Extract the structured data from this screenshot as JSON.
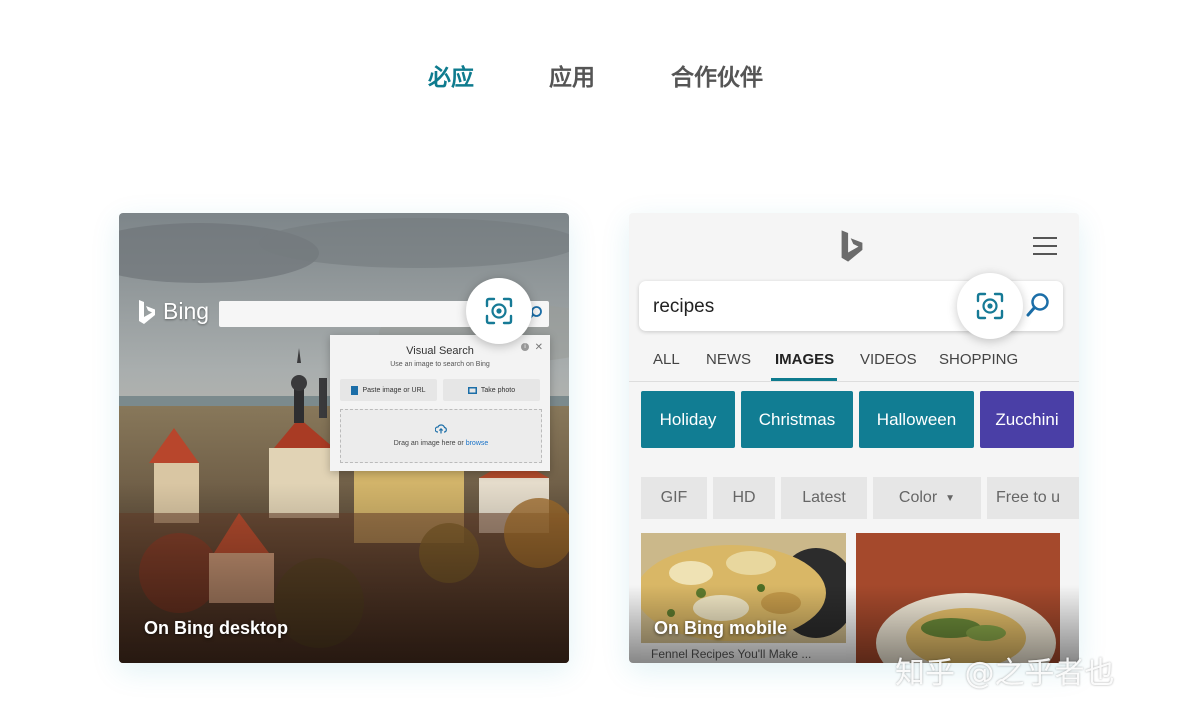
{
  "tabs": [
    {
      "label": "必应",
      "active": true
    },
    {
      "label": "应用",
      "active": false
    },
    {
      "label": "合作伙伴",
      "active": false
    }
  ],
  "desktop_card": {
    "caption": "On Bing desktop",
    "logo_text": "Bing",
    "visual_search": {
      "title": "Visual Search",
      "subtitle": "Use an image to search on Bing",
      "paste_label": "Paste image or URL",
      "photo_label": "Take photo",
      "drop_text": "Drag an image here or",
      "drop_link": "browse"
    }
  },
  "mobile_card": {
    "caption": "On Bing mobile",
    "search_value": "recipes",
    "nav": [
      "ALL",
      "NEWS",
      "IMAGES",
      "VIDEOS",
      "SHOPPING"
    ],
    "nav_active": "IMAGES",
    "chips": [
      {
        "label": "Holiday",
        "color": "#117d93"
      },
      {
        "label": "Christmas",
        "color": "#117d93"
      },
      {
        "label": "Halloween",
        "color": "#117d93"
      },
      {
        "label": "Zucchini",
        "color": "#4a3fa6"
      }
    ],
    "filters": [
      "GIF",
      "HD",
      "Latest",
      "Color",
      "Free to u"
    ],
    "image_caption": "Fennel Recipes You'll Make ..."
  },
  "colors": {
    "accent": "#0e7b8e",
    "tab_inactive": "#555555"
  },
  "watermark": "知乎 @之乎者也"
}
